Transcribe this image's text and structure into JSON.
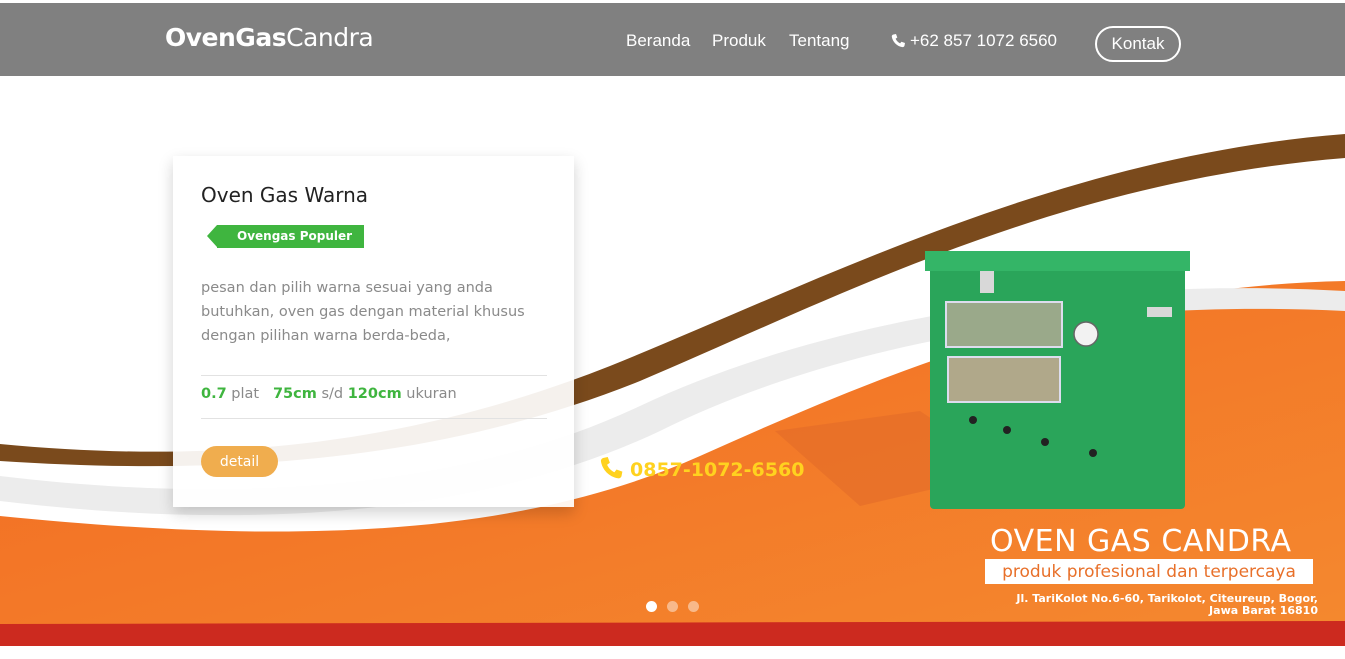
{
  "navbar": {
    "brand_bold": "OvenGas",
    "brand_light": "Candra",
    "links": [
      "Beranda",
      "Produk",
      "Tentang"
    ],
    "phone": "+62 857 1072 6560",
    "contact_button": "Kontak"
  },
  "slide": {
    "title": "Oven Gas Warna",
    "tag": "Ovengas Populer",
    "description": "pesan dan pilih warna sesuai yang anda butuhkan, oven gas dengan material khusus dengan pilihan warna berda-beda,",
    "specs": {
      "plate_value": "0.7",
      "plate_label": "plat",
      "size_min": "75cm",
      "size_sep": "s/d",
      "size_max": "120cm",
      "size_label": "ukuran"
    },
    "detail_button": "detail"
  },
  "banner": {
    "phone": "0857-1072-6560",
    "brand": "OVEN GAS CANDRA",
    "slogan": "produk profesional dan terpercaya",
    "address_line1": "Jl. TariKolot No.6-60, Tarikolot, Citeureup, Bogor,",
    "address_line2": "Jawa Barat 16810"
  },
  "carousel": {
    "slides": 3,
    "active": 1
  },
  "colors": {
    "navbar": "#808080",
    "accent_green": "#3fb53f",
    "button_orange": "#f0ad4e",
    "banner_orange": "#f07a2a",
    "wave_brown": "#7a4a1c"
  }
}
